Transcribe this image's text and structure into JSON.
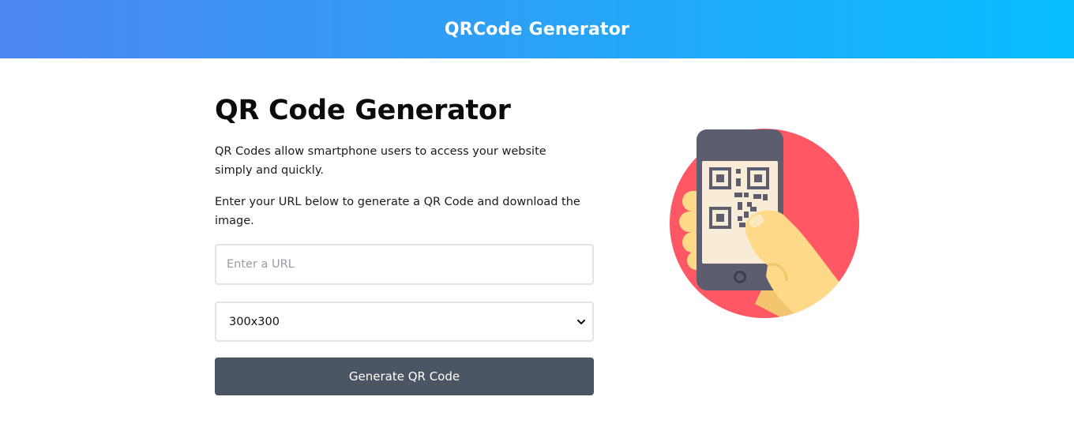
{
  "header": {
    "title": "QRCode Generator"
  },
  "main": {
    "heading": "QR Code Generator",
    "paragraph1": "QR Codes allow smartphone users to access your website simply and quickly.",
    "paragraph2": "Enter your URL below to generate a QR Code and download the image.",
    "url_input": {
      "placeholder": "Enter a URL",
      "value": ""
    },
    "size_select": {
      "selected": "300x300"
    },
    "generate_button": "Generate QR Code"
  },
  "colors": {
    "header_gradient_start": "#4d88f0",
    "header_gradient_end": "#06beff",
    "button_bg": "#4b5563",
    "illustration_circle": "#ff5763",
    "phone_body": "#5c5d6f",
    "phone_screen": "#f9ecd6",
    "hand": "#fdd988"
  },
  "icons": {
    "illustration": "phone-scanning-qr-code-illustration",
    "select_arrow": "chevron-down-icon"
  }
}
